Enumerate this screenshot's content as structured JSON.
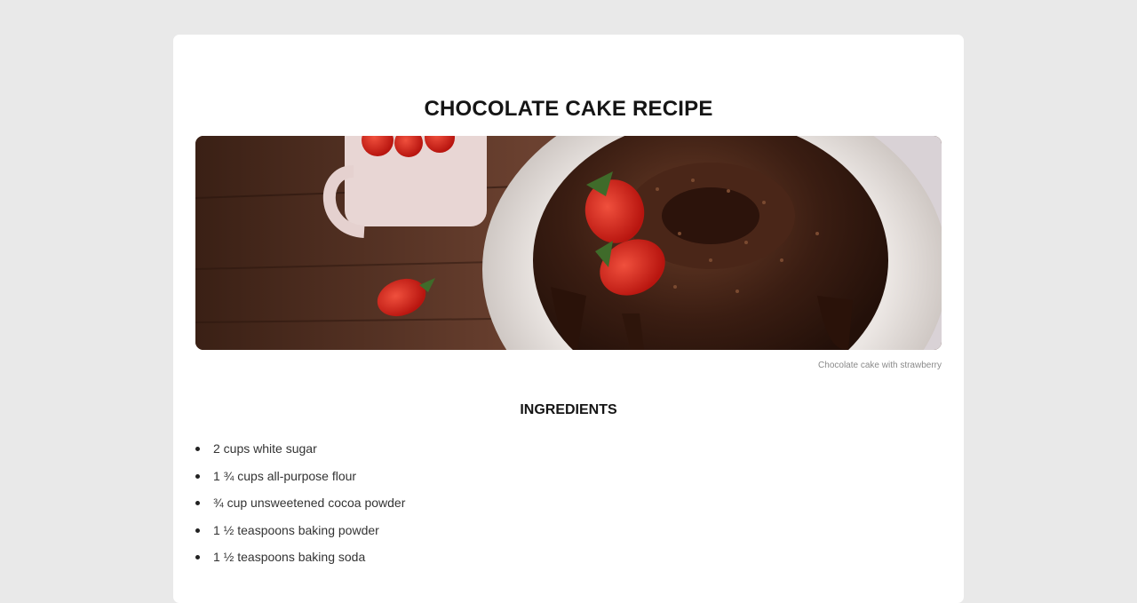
{
  "recipe": {
    "title": "CHOCOLATE CAKE RECIPE",
    "image_caption": "Chocolate cake with strawberry",
    "ingredients_heading": "INGREDIENTS",
    "ingredients": [
      "2 cups white sugar",
      "1 ¾ cups all-purpose flour",
      "¾ cup unsweetened cocoa powder",
      "1 ½ teaspoons baking powder",
      "1 ½ teaspoons baking soda"
    ]
  },
  "colors": {
    "page_background": "#e9e9e9",
    "card_background": "#ffffff",
    "heading": "#151515",
    "caption": "#8a8a8a"
  }
}
